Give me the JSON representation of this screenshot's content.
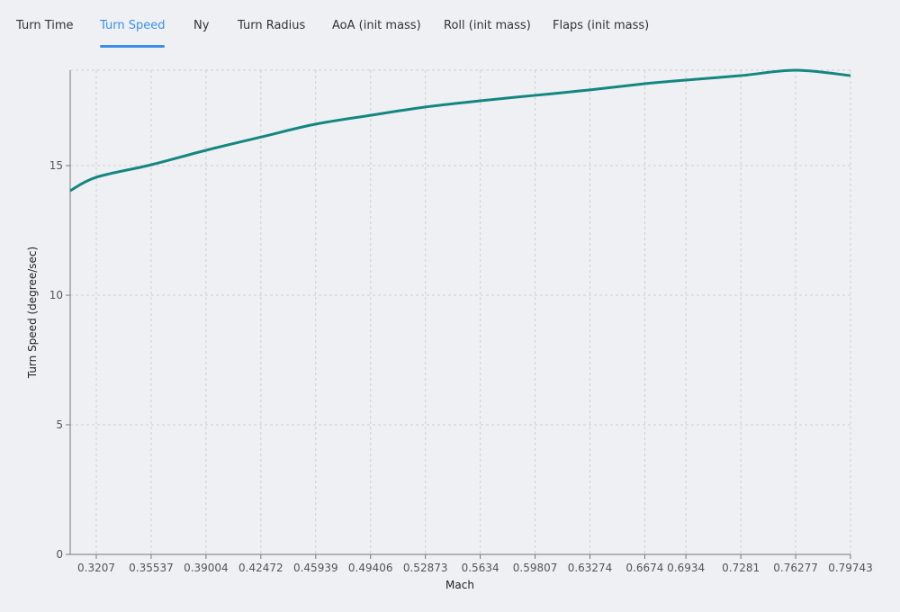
{
  "tabs": [
    {
      "label": "Turn Time",
      "active": false
    },
    {
      "label": "Turn Speed",
      "active": true
    },
    {
      "label": "Ny",
      "active": false
    },
    {
      "label": "Turn Radius",
      "active": false
    },
    {
      "label": "AoA (init mass)",
      "active": false
    },
    {
      "label": "Roll (init mass)",
      "active": false
    },
    {
      "label": "Flaps (init mass)",
      "active": false
    }
  ],
  "colors": {
    "line": "#13877f",
    "accent": "#3b8fe8",
    "grid": "#cfcfcf"
  },
  "chart_data": {
    "type": "line",
    "title": "",
    "xlabel": "Mach",
    "ylabel": "Turn Speed (degree/sec)",
    "xlim": [
      0.3042,
      0.79743
    ],
    "ylim": [
      0,
      18.68
    ],
    "grid": true,
    "x_ticks": [
      "0.3207",
      "0.35537",
      "0.39004",
      "0.42472",
      "0.45939",
      "0.49406",
      "0.52873",
      "0.5634",
      "0.59807",
      "0.63274",
      "0.6674",
      "0.6934",
      "0.7281",
      "0.76277",
      "0.79743"
    ],
    "y_ticks": [
      "0",
      "5",
      "10",
      "15"
    ],
    "series": [
      {
        "name": "Turn Speed",
        "x": [
          0.3042,
          0.3207,
          0.35537,
          0.39004,
          0.42472,
          0.45939,
          0.49406,
          0.52873,
          0.5634,
          0.59807,
          0.63274,
          0.6674,
          0.6934,
          0.7281,
          0.76277,
          0.79743
        ],
        "y": [
          14.03,
          14.55,
          15.03,
          15.59,
          16.1,
          16.6,
          16.94,
          17.26,
          17.5,
          17.71,
          17.92,
          18.16,
          18.3,
          18.47,
          18.68,
          18.47
        ]
      }
    ]
  }
}
